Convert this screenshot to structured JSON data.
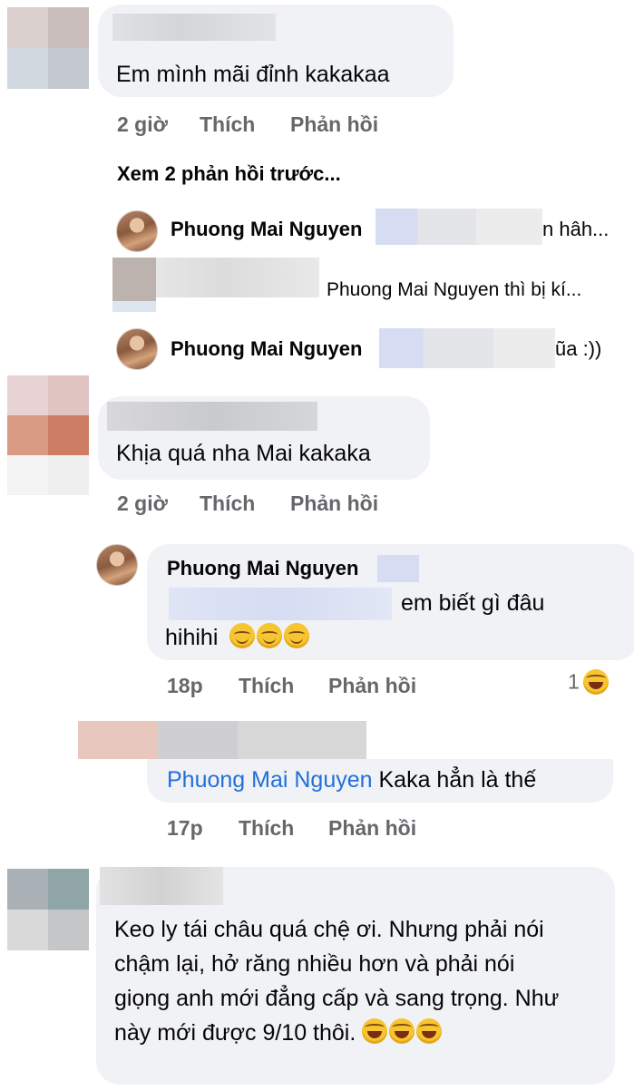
{
  "comments": [
    {
      "text": "Em mình mãi đỉnh kakakaa",
      "time": "2 giờ",
      "like": "Thích",
      "reply": "Phản hồi"
    },
    {
      "text": "Khịa quá nha Mai kakaka",
      "time": "2 giờ",
      "like": "Thích",
      "reply": "Phản hồi"
    },
    {
      "text": "Keo ly tái châu quá chệ ơi. Nhưng phải nói chậm lại, hở răng nhiều hơn và phải nói giọng anh mới đẳng cấp và sang trọng. Như này mới được 9/10 thôi."
    }
  ],
  "view_previous": "Xem 2 phản hồi trước...",
  "collapsed_replies": [
    {
      "name": "Phuong Mai Nguyen",
      "snippet": "n hâh..."
    },
    {
      "mention": "Phuong Mai Nguyen thì bị kí..."
    },
    {
      "name": "Phuong Mai Nguyen",
      "snippet": "ũa :))"
    }
  ],
  "reply_pmn": {
    "name": "Phuong Mai Nguyen",
    "text_end": "em biết gì đâu",
    "text_line2": "hihihi",
    "time": "18p",
    "like": "Thích",
    "reply": "Phản hồi",
    "reaction_count": "1"
  },
  "reply_other": {
    "mention": "Phuong Mai Nguyen",
    "text": "Kaka hẳn là thế",
    "time": "17p",
    "like": "Thích",
    "reply": "Phản hồi"
  },
  "colors": {
    "bubble": "#f0f2f5",
    "meta": "#65676b",
    "link": "#216fdb",
    "text": "#050505"
  }
}
